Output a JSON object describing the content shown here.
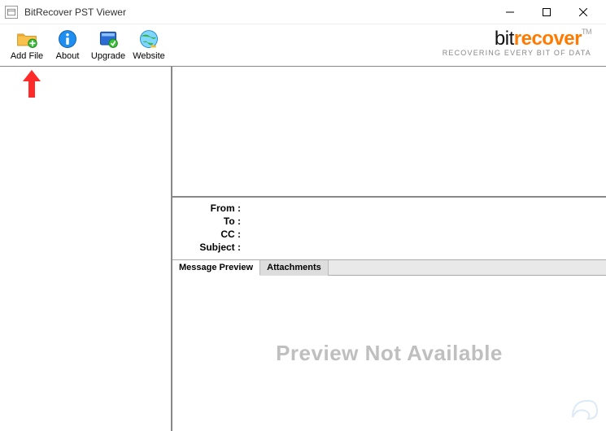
{
  "window": {
    "title": "BitRecover PST Viewer"
  },
  "toolbar": {
    "add_file": "Add File",
    "about": "About",
    "upgrade": "Upgrade",
    "website": "Website"
  },
  "brand": {
    "part1": "bit",
    "part2": "recover",
    "tm": "TM",
    "tagline": "RECOVERING EVERY BIT OF DATA"
  },
  "headers": {
    "from_label": "From :",
    "to_label": "To :",
    "cc_label": "CC :",
    "subject_label": "Subject :",
    "from_val": "",
    "to_val": "",
    "cc_val": "",
    "subject_val": ""
  },
  "tabs": {
    "message_preview": "Message Preview",
    "attachments": "Attachments"
  },
  "preview": {
    "not_available": "Preview Not Available"
  },
  "colors": {
    "accent_orange": "#ff7a00",
    "annotation_red": "#ff2a2a"
  }
}
